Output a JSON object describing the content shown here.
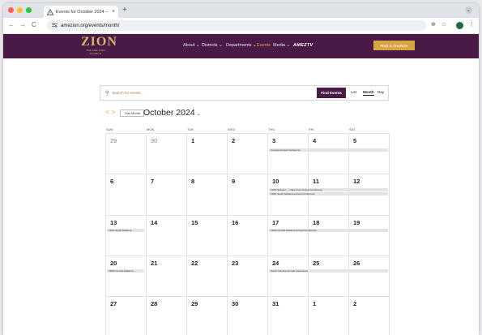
{
  "browser": {
    "tab_title": "Events for October 2024 – Th",
    "tab_close": "×",
    "new_tab": "+",
    "url": "amezion.org/events/month/",
    "nav": {
      "back": "←",
      "forward": "→",
      "reload": "C"
    },
    "tab_dropdown": "⌄",
    "zoom_icon": "⊕",
    "star_icon": "☆",
    "menu_icon": "⋮"
  },
  "site": {
    "logo": "ZION",
    "logo_sub": "THE AME ZION CHURCH",
    "nav": [
      {
        "label": "About ⌄"
      },
      {
        "label": "Districts ⌄"
      },
      {
        "label": "Departments ⌄"
      },
      {
        "label": "Events"
      },
      {
        "label": "Media ⌄"
      },
      {
        "label": "AMEZTV"
      }
    ],
    "find_church": "FIND A CHURCH"
  },
  "events_bar": {
    "search_icon": "⚲",
    "search_placeholder": "Search for events",
    "find_button": "Find Events",
    "views": [
      "List",
      "Month",
      "Day"
    ],
    "active_view": "Month"
  },
  "month_nav": {
    "prev": "<",
    "next": ">",
    "this_month": "This Month",
    "title": "October 2024",
    "caret": "⌄"
  },
  "calendar": {
    "weekdays": [
      "SUN",
      "MON",
      "TUE",
      "WED",
      "THU",
      "FRI",
      "SAT"
    ],
    "weeks": [
      [
        "29",
        "30",
        "1",
        "2",
        "3",
        "4",
        "5"
      ],
      [
        "6",
        "7",
        "8",
        "9",
        "10",
        "11",
        "12"
      ],
      [
        "13",
        "14",
        "15",
        "16",
        "17",
        "18",
        "19"
      ],
      [
        "20",
        "21",
        "22",
        "23",
        "24",
        "25",
        "26"
      ],
      [
        "27",
        "28",
        "29",
        "30",
        "31",
        "1",
        "2"
      ]
    ],
    "events": [
      "Georgia Annual Conference",
      "110th Session — Cape Fear Annual Conference",
      "110th South Alabama Annual Conference",
      "110th South Alabama ...",
      "129th Central Alabama Annual Conference",
      "129th Central Alabama ...",
      "South Carolina Annual Conference"
    ]
  },
  "colors": {
    "brand_purple": "#4a1a47",
    "accent_gold": "#d9a441",
    "nav_active": "#e8a63a"
  }
}
